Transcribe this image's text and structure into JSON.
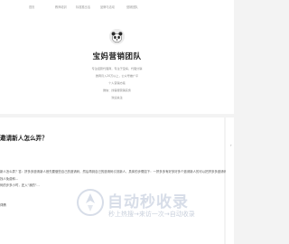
{
  "nav": {
    "items": [
      "首页",
      "教师培训",
      "标准推出活",
      "品牌与活动",
      "营销团队"
    ]
  },
  "profile": {
    "site_title": "宝妈营销团队",
    "description_lines": [
      "专注招募代理商，专注于宝妈，代理分销",
      "微商月入20万以上，公众号推广平",
      "个人营销方案",
      "微信：找客服营销实务",
      "欢迎关注"
    ]
  },
  "article": {
    "title": "邀请新人怎么弄？",
    "body": "新人怎么弄？答：拼多多邀请新人首先要做些自己的邀请码，然后再到自己的邀请码引流新人，具体的步骤如下：一拼多多有好多好多个邀请新人的可以把拼多多邀请码找人免费和...",
    "body_tail": "码的步多小时，还入\"我的\"...",
    "read_more": "详情"
  },
  "side_glyph": "›",
  "watermark": {
    "title": "自动秒收录",
    "tagline": "秒上热搜→来访一次→自动收录"
  },
  "colors": {
    "background": "#f3f3f3",
    "card": "#ffffff",
    "watermark": "#d7dde8"
  },
  "icons": {
    "avatar": "panda-avatar-icon",
    "watermark_logo": "rocket-icon"
  }
}
